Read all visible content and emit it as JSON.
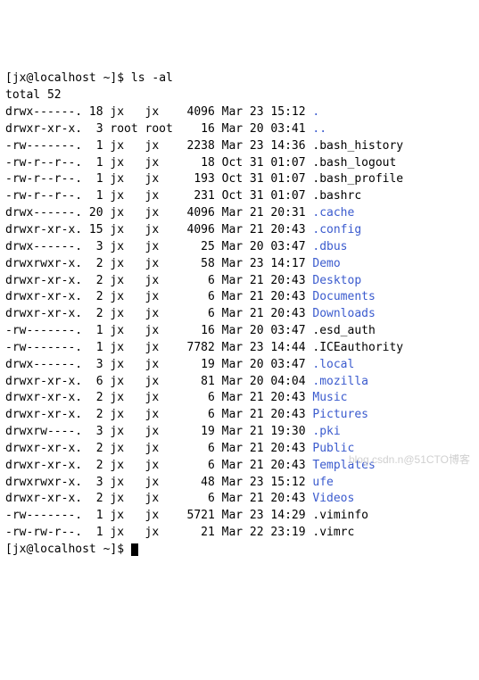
{
  "prompt1": {
    "user": "[jx@localhost ~]$",
    "command": "ls -al"
  },
  "total_line": "total 52",
  "entries": [
    {
      "perm": "drwx------.",
      "links": "18",
      "owner": "jx",
      "group": "jx",
      "size": "4096",
      "month": "Mar",
      "day": "23",
      "time": "15:12",
      "name": ".",
      "type": "dir"
    },
    {
      "perm": "drwxr-xr-x.",
      "links": "3",
      "owner": "root",
      "group": "root",
      "size": "16",
      "month": "Mar",
      "day": "20",
      "time": "03:41",
      "name": "..",
      "type": "dir"
    },
    {
      "perm": "-rw-------.",
      "links": "1",
      "owner": "jx",
      "group": "jx",
      "size": "2238",
      "month": "Mar",
      "day": "23",
      "time": "14:36",
      "name": ".bash_history",
      "type": "file"
    },
    {
      "perm": "-rw-r--r--.",
      "links": "1",
      "owner": "jx",
      "group": "jx",
      "size": "18",
      "month": "Oct",
      "day": "31",
      "time": "01:07",
      "name": ".bash_logout",
      "type": "file"
    },
    {
      "perm": "-rw-r--r--.",
      "links": "1",
      "owner": "jx",
      "group": "jx",
      "size": "193",
      "month": "Oct",
      "day": "31",
      "time": "01:07",
      "name": ".bash_profile",
      "type": "file"
    },
    {
      "perm": "-rw-r--r--.",
      "links": "1",
      "owner": "jx",
      "group": "jx",
      "size": "231",
      "month": "Oct",
      "day": "31",
      "time": "01:07",
      "name": ".bashrc",
      "type": "file"
    },
    {
      "perm": "drwx------.",
      "links": "20",
      "owner": "jx",
      "group": "jx",
      "size": "4096",
      "month": "Mar",
      "day": "21",
      "time": "20:31",
      "name": ".cache",
      "type": "dir"
    },
    {
      "perm": "drwxr-xr-x.",
      "links": "15",
      "owner": "jx",
      "group": "jx",
      "size": "4096",
      "month": "Mar",
      "day": "21",
      "time": "20:43",
      "name": ".config",
      "type": "dir"
    },
    {
      "perm": "drwx------.",
      "links": "3",
      "owner": "jx",
      "group": "jx",
      "size": "25",
      "month": "Mar",
      "day": "20",
      "time": "03:47",
      "name": ".dbus",
      "type": "dir"
    },
    {
      "perm": "drwxrwxr-x.",
      "links": "2",
      "owner": "jx",
      "group": "jx",
      "size": "58",
      "month": "Mar",
      "day": "23",
      "time": "14:17",
      "name": "Demo",
      "type": "dir"
    },
    {
      "perm": "drwxr-xr-x.",
      "links": "2",
      "owner": "jx",
      "group": "jx",
      "size": "6",
      "month": "Mar",
      "day": "21",
      "time": "20:43",
      "name": "Desktop",
      "type": "dir"
    },
    {
      "perm": "drwxr-xr-x.",
      "links": "2",
      "owner": "jx",
      "group": "jx",
      "size": "6",
      "month": "Mar",
      "day": "21",
      "time": "20:43",
      "name": "Documents",
      "type": "dir"
    },
    {
      "perm": "drwxr-xr-x.",
      "links": "2",
      "owner": "jx",
      "group": "jx",
      "size": "6",
      "month": "Mar",
      "day": "21",
      "time": "20:43",
      "name": "Downloads",
      "type": "dir"
    },
    {
      "perm": "-rw-------.",
      "links": "1",
      "owner": "jx",
      "group": "jx",
      "size": "16",
      "month": "Mar",
      "day": "20",
      "time": "03:47",
      "name": ".esd_auth",
      "type": "file"
    },
    {
      "perm": "-rw-------.",
      "links": "1",
      "owner": "jx",
      "group": "jx",
      "size": "7782",
      "month": "Mar",
      "day": "23",
      "time": "14:44",
      "name": ".ICEauthority",
      "type": "file"
    },
    {
      "perm": "drwx------.",
      "links": "3",
      "owner": "jx",
      "group": "jx",
      "size": "19",
      "month": "Mar",
      "day": "20",
      "time": "03:47",
      "name": ".local",
      "type": "dir"
    },
    {
      "perm": "drwxr-xr-x.",
      "links": "6",
      "owner": "jx",
      "group": "jx",
      "size": "81",
      "month": "Mar",
      "day": "20",
      "time": "04:04",
      "name": ".mozilla",
      "type": "dir"
    },
    {
      "perm": "drwxr-xr-x.",
      "links": "2",
      "owner": "jx",
      "group": "jx",
      "size": "6",
      "month": "Mar",
      "day": "21",
      "time": "20:43",
      "name": "Music",
      "type": "dir"
    },
    {
      "perm": "drwxr-xr-x.",
      "links": "2",
      "owner": "jx",
      "group": "jx",
      "size": "6",
      "month": "Mar",
      "day": "21",
      "time": "20:43",
      "name": "Pictures",
      "type": "dir"
    },
    {
      "perm": "drwxrw----.",
      "links": "3",
      "owner": "jx",
      "group": "jx",
      "size": "19",
      "month": "Mar",
      "day": "21",
      "time": "19:30",
      "name": ".pki",
      "type": "dir"
    },
    {
      "perm": "drwxr-xr-x.",
      "links": "2",
      "owner": "jx",
      "group": "jx",
      "size": "6",
      "month": "Mar",
      "day": "21",
      "time": "20:43",
      "name": "Public",
      "type": "dir"
    },
    {
      "perm": "drwxr-xr-x.",
      "links": "2",
      "owner": "jx",
      "group": "jx",
      "size": "6",
      "month": "Mar",
      "day": "21",
      "time": "20:43",
      "name": "Templates",
      "type": "dir"
    },
    {
      "perm": "drwxrwxr-x.",
      "links": "3",
      "owner": "jx",
      "group": "jx",
      "size": "48",
      "month": "Mar",
      "day": "23",
      "time": "15:12",
      "name": "ufe",
      "type": "dir"
    },
    {
      "perm": "drwxr-xr-x.",
      "links": "2",
      "owner": "jx",
      "group": "jx",
      "size": "6",
      "month": "Mar",
      "day": "21",
      "time": "20:43",
      "name": "Videos",
      "type": "dir"
    },
    {
      "perm": "-rw-------.",
      "links": "1",
      "owner": "jx",
      "group": "jx",
      "size": "5721",
      "month": "Mar",
      "day": "23",
      "time": "14:29",
      "name": ".viminfo",
      "type": "file"
    },
    {
      "perm": "-rw-rw-r--.",
      "links": "1",
      "owner": "jx",
      "group": "jx",
      "size": "21",
      "month": "Mar",
      "day": "22",
      "time": "23:19",
      "name": ".vimrc",
      "type": "file"
    }
  ],
  "prompt2": {
    "user": "[jx@localhost ~]$"
  },
  "watermark": "blog.csdn.n@51CTO博客"
}
